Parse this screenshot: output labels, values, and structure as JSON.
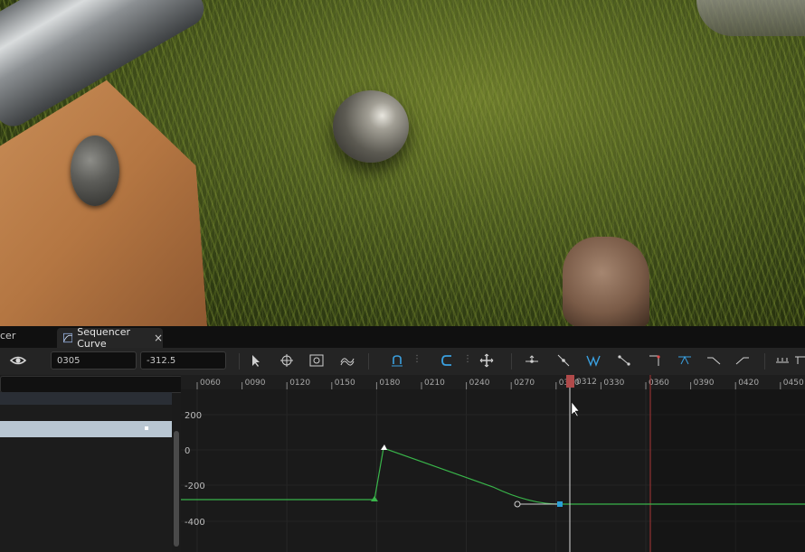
{
  "tabs": {
    "previous": "cer",
    "active": "Sequencer Curve",
    "close": "×"
  },
  "toolbar": {
    "frame_value": "0305",
    "key_value": "-312.5"
  },
  "timeline": {
    "ticks": [
      "0060",
      "0090",
      "0120",
      "0150",
      "0180",
      "0210",
      "0240",
      "0270",
      "0300",
      "0330",
      "0360",
      "0390",
      "0420",
      "0450"
    ],
    "playhead_label": "0312"
  },
  "graph": {
    "y_labels": [
      "200",
      "0",
      "-200",
      "-400"
    ]
  },
  "colors": {
    "curve": "#39b54a",
    "playhead": "#d9d9d9",
    "end_marker": "#a53232",
    "key_selected": "#2a9fd6"
  },
  "icons": [
    "eye-icon",
    "select-arrow-icon",
    "frame-all-icon",
    "time-scale-icon",
    "curve-wave-icon",
    "snap-icon",
    "magnet-icon",
    "move-icon",
    "flatten-icon",
    "straighten-icon",
    "auto-tangent-icon",
    "linear-icon",
    "step-icon",
    "break-tangent-icon",
    "pre-infinity-icon",
    "post-infinity-icon"
  ]
}
